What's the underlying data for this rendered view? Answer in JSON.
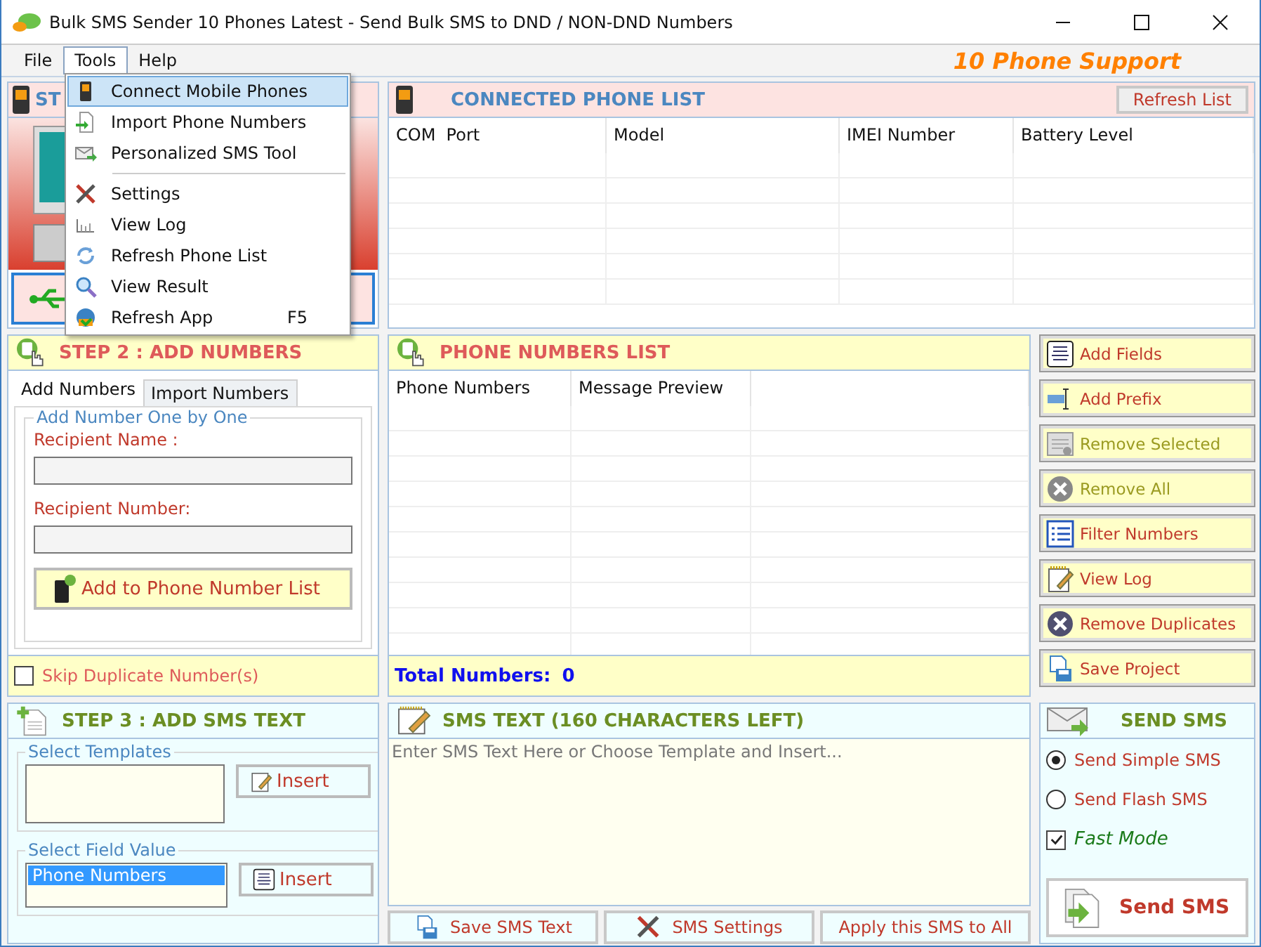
{
  "window": {
    "title": "Bulk SMS Sender 10 Phones Latest - Send Bulk SMS to DND / NON-DND Numbers"
  },
  "menu_bar": {
    "items": [
      {
        "label": "File",
        "selected": false
      },
      {
        "label": "Tools",
        "selected": true
      },
      {
        "label": "Help",
        "selected": false
      }
    ],
    "tagline": "10 Phone Support"
  },
  "tools_menu": {
    "items": [
      {
        "kind": "item",
        "label": "Connect Mobile Phones",
        "selected": true
      },
      {
        "kind": "item",
        "label": "Import Phone Numbers",
        "selected": false
      },
      {
        "kind": "item",
        "label": "Personalized SMS Tool",
        "selected": false
      },
      {
        "kind": "separator"
      },
      {
        "kind": "item",
        "label": "Settings",
        "selected": false
      },
      {
        "kind": "item",
        "label": "View Log",
        "selected": false
      },
      {
        "kind": "item",
        "label": "Refresh Phone List",
        "selected": false
      },
      {
        "kind": "item",
        "label": "View Result",
        "selected": false
      },
      {
        "kind": "item",
        "label": "Refresh App",
        "shortcut": "F5",
        "selected": false
      }
    ]
  },
  "step1": {
    "title": "ST"
  },
  "connected_phones": {
    "title": "CONNECTED PHONE LIST",
    "refresh_button": "Refresh List",
    "columns": [
      "COM  Port",
      "Model",
      "IMEI Number",
      "Battery Level"
    ]
  },
  "step2": {
    "title": "STEP 2 : ADD NUMBERS",
    "tabs": [
      {
        "label": "Add Numbers",
        "selected": true
      },
      {
        "label": "Import Numbers",
        "selected": false
      }
    ],
    "group_title": "Add Number One by One",
    "name_label": "Recipient Name :",
    "number_label": "Recipient Number:",
    "add_button": "Add to Phone Number List",
    "skip_duplicates": {
      "label": "Skip Duplicate Number(s)",
      "checked": false
    }
  },
  "phone_numbers": {
    "title": "PHONE NUMBERS LIST",
    "columns": [
      "Phone Numbers",
      "Message Preview"
    ],
    "total_label": "Total Numbers:",
    "total_value": "0"
  },
  "side_buttons": [
    {
      "label": "Add Fields",
      "disabled": false
    },
    {
      "label": "Add Prefix",
      "disabled": false
    },
    {
      "label": "Remove Selected",
      "disabled": true
    },
    {
      "label": "Remove All",
      "disabled": true
    },
    {
      "label": "Filter Numbers",
      "disabled": false
    },
    {
      "label": "View Log",
      "disabled": false
    },
    {
      "label": "Remove Duplicates",
      "disabled": false
    },
    {
      "label": "Save Project",
      "disabled": false
    }
  ],
  "step3": {
    "title": "STEP 3 : ADD SMS TEXT",
    "templates_title": "Select Templates",
    "templates_insert": "Insert",
    "fields_title": "Select Field Value",
    "field_items": [
      {
        "label": "Phone Numbers",
        "selected": true
      }
    ],
    "fields_insert": "Insert"
  },
  "sms_text": {
    "title": "SMS TEXT (160 CHARACTERS LEFT)",
    "placeholder": "Enter SMS Text Here or Choose Template and Insert...",
    "buttons": [
      "Save SMS Text",
      "SMS Settings",
      "Apply this SMS to All"
    ]
  },
  "send_sms": {
    "title": "SEND SMS",
    "modes": [
      {
        "label": "Send Simple SMS",
        "selected": true
      },
      {
        "label": "Send Flash SMS",
        "selected": false
      }
    ],
    "fast_mode": {
      "label": "Fast Mode",
      "checked": true
    },
    "send_button": "Send SMS"
  }
}
